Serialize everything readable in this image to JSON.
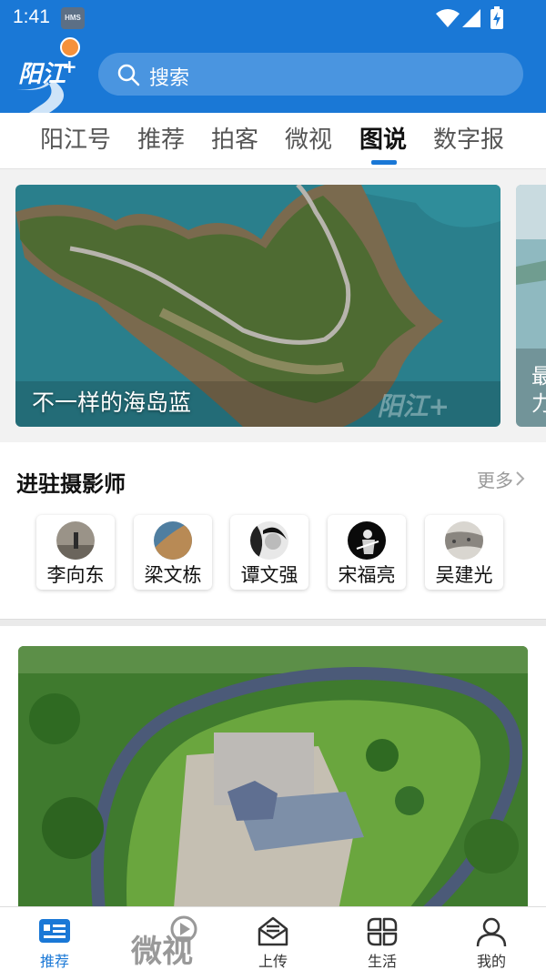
{
  "status_bar": {
    "time": "1:41",
    "hms_badge": "HMS"
  },
  "search": {
    "placeholder": "搜索"
  },
  "logo": {
    "text": "阳江",
    "plus": "+"
  },
  "tabs": [
    {
      "label": "阳江号",
      "active": false
    },
    {
      "label": "推荐",
      "active": false
    },
    {
      "label": "拍客",
      "active": false
    },
    {
      "label": "微视",
      "active": false
    },
    {
      "label": "图说",
      "active": true
    },
    {
      "label": "数字报",
      "active": false
    }
  ],
  "carousel": {
    "slides": [
      {
        "caption": "不一样的海岛蓝",
        "watermark": "阳江+"
      },
      {
        "caption": "最力"
      }
    ]
  },
  "photographers_section": {
    "title": "进驻摄影师",
    "more_label": "更多",
    "people": [
      {
        "name": "李向东"
      },
      {
        "name": "梁文栋"
      },
      {
        "name": "谭文强"
      },
      {
        "name": "宋福亮"
      },
      {
        "name": "吴建光"
      }
    ]
  },
  "bottom_nav": {
    "items": [
      {
        "label": "推荐",
        "icon": "news-icon",
        "active": true
      },
      {
        "label": "",
        "icon": "weishi-logo",
        "logo_text": "微视",
        "active": false
      },
      {
        "label": "上传",
        "icon": "upload-icon",
        "active": false
      },
      {
        "label": "生活",
        "icon": "life-icon",
        "active": false
      },
      {
        "label": "我的",
        "icon": "user-icon",
        "active": false
      }
    ]
  },
  "colors": {
    "brand_blue": "#1a78d6",
    "search_bg": "#4a95e0",
    "accent_orange": "#f5913b"
  }
}
